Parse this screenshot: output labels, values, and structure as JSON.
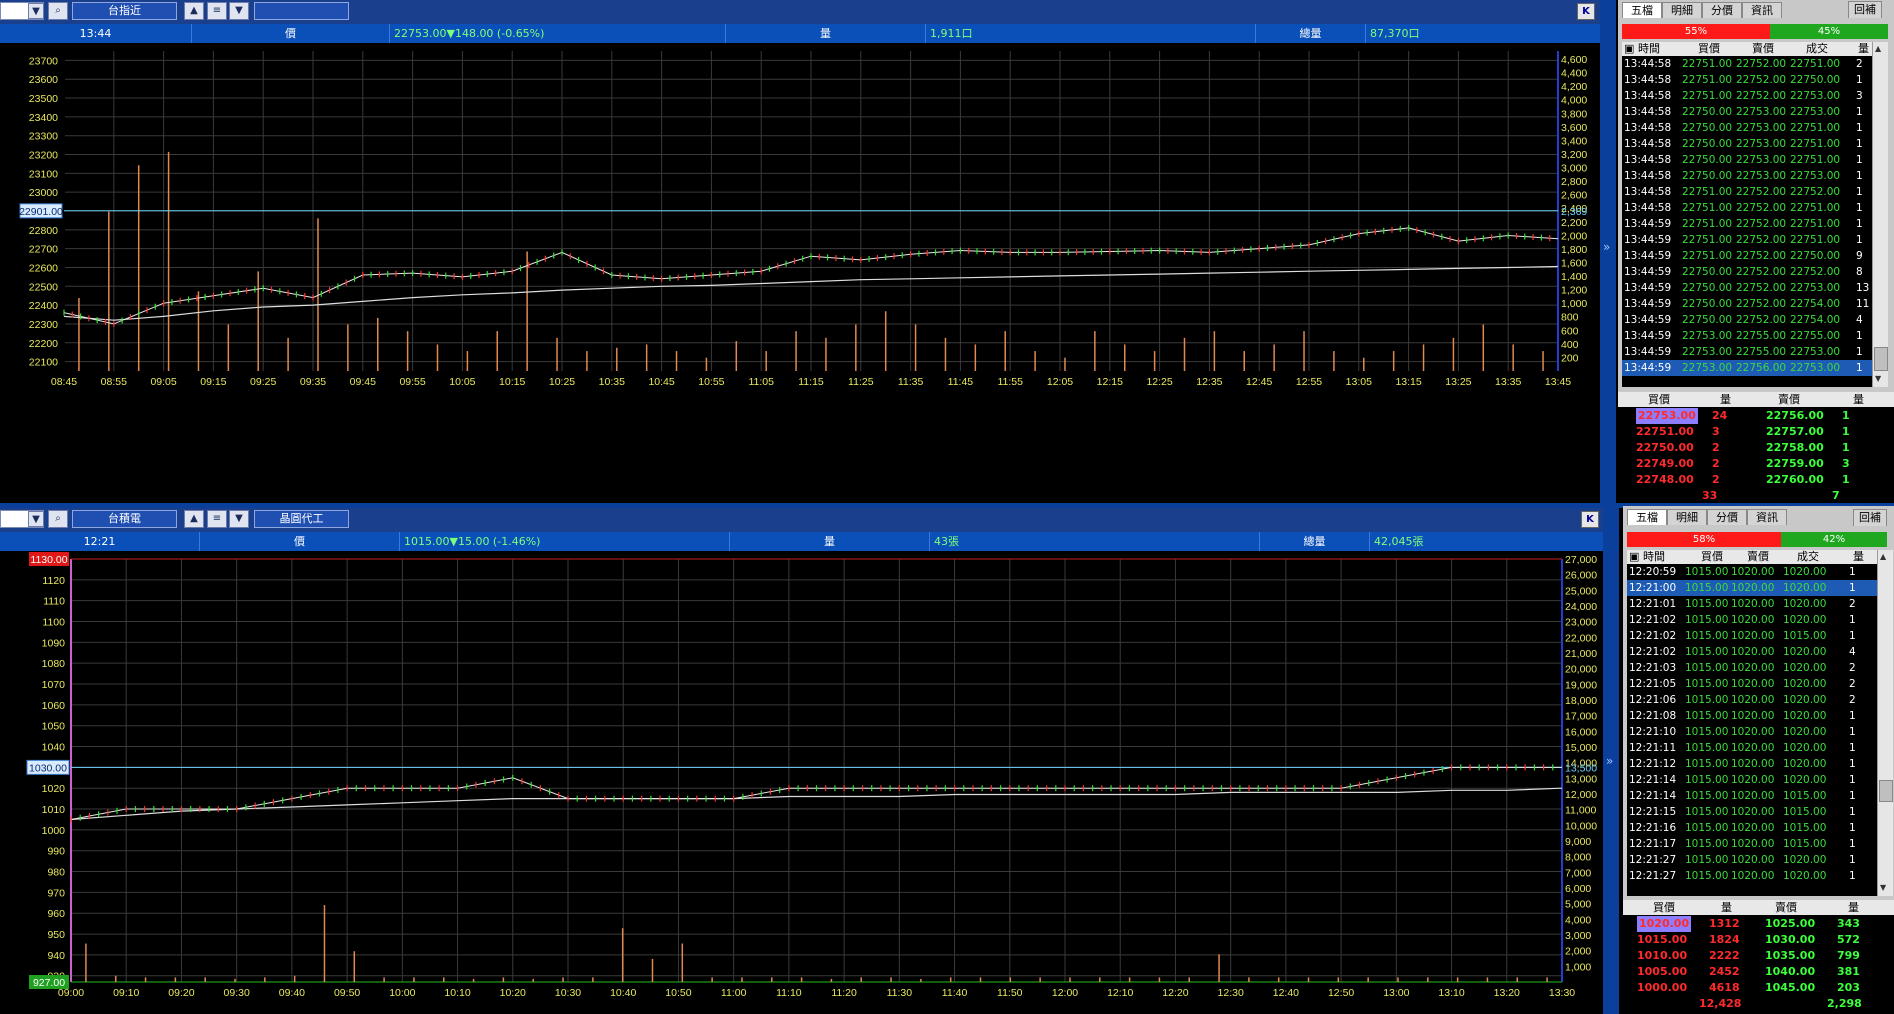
{
  "top": {
    "toolbar": {
      "code_value": "",
      "symbol_name": "台指近",
      "category": "",
      "k_label": "K"
    },
    "info": {
      "time": "13:44",
      "price_label": "價",
      "price_value": "22753.00▼148.00 (-0.65%)",
      "vol_label": "量",
      "vol_value": "1,911口",
      "total_label": "總量",
      "total_value": "87,370口"
    },
    "ref_price": "22901.00",
    "ref_right_label": "2,369",
    "y_ticks": [
      "23700",
      "23600",
      "23500",
      "23400",
      "23300",
      "23200",
      "23100",
      "23000",
      "22900",
      "22800",
      "22700",
      "22600",
      "22500",
      "22400",
      "22300",
      "22200",
      "22100"
    ],
    "vol_ticks": [
      "4,600",
      "4,400",
      "4,200",
      "4,000",
      "3,800",
      "3,600",
      "3,400",
      "3,200",
      "3,000",
      "2,800",
      "2,600",
      "2,400",
      "2,200",
      "2,000",
      "1,800",
      "1,600",
      "1,400",
      "1,200",
      "1,000",
      "800",
      "600",
      "400",
      "200"
    ],
    "x_ticks": [
      "08:45",
      "08:55",
      "09:05",
      "09:15",
      "09:25",
      "09:35",
      "09:45",
      "09:55",
      "10:05",
      "10:15",
      "10:25",
      "10:35",
      "10:45",
      "10:55",
      "11:05",
      "11:15",
      "11:25",
      "11:35",
      "11:45",
      "11:55",
      "12:05",
      "12:15",
      "12:25",
      "12:35",
      "12:45",
      "12:55",
      "13:05",
      "13:15",
      "13:25",
      "13:35",
      "13:45"
    ],
    "chart_data": {
      "type": "line",
      "series": [
        {
          "x": [
            "08:45",
            "08:55",
            "09:05",
            "09:15",
            "09:25",
            "09:35",
            "09:45",
            "09:55",
            "10:05",
            "10:15",
            "10:25",
            "10:35",
            "10:45",
            "10:55",
            "11:05",
            "11:15",
            "11:25",
            "11:35",
            "11:45",
            "11:55",
            "12:05",
            "12:15",
            "12:25",
            "12:35",
            "12:45",
            "12:55",
            "13:05",
            "13:15",
            "13:25",
            "13:35",
            "13:45"
          ],
          "values": [
            22360,
            22300,
            22410,
            22450,
            22490,
            22440,
            22560,
            22570,
            22550,
            22580,
            22680,
            22560,
            22540,
            22560,
            22580,
            22660,
            22640,
            22670,
            22690,
            22680,
            22680,
            22685,
            22690,
            22680,
            22700,
            22720,
            22780,
            22810,
            22740,
            22770,
            22753
          ]
        },
        {
          "x": [
            "08:45",
            "08:55",
            "09:05",
            "09:15",
            "09:25",
            "09:35",
            "09:45",
            "09:55",
            "10:05",
            "10:15",
            "10:25",
            "10:35",
            "10:45",
            "10:55",
            "11:05",
            "11:15",
            "11:25",
            "11:35",
            "11:45",
            "11:55",
            "12:05",
            "12:15",
            "12:25",
            "12:35",
            "12:45",
            "12:55",
            "13:05",
            "13:15",
            "13:25",
            "13:35",
            "13:45"
          ],
          "values": [
            22340,
            22320,
            22340,
            22370,
            22390,
            22400,
            22420,
            22440,
            22455,
            22465,
            22480,
            22490,
            22500,
            22505,
            22515,
            22525,
            22535,
            22540,
            22545,
            22550,
            22555,
            22560,
            22565,
            22570,
            22575,
            22580,
            22585,
            22590,
            22595,
            22600,
            22605
          ]
        }
      ],
      "ylim": [
        22050,
        23750
      ],
      "volume_max": 4700,
      "volumes": [
        1100,
        2400,
        3100,
        3300,
        1200,
        700,
        1500,
        500,
        2300,
        700,
        800,
        600,
        400,
        300,
        600,
        1800,
        500,
        300,
        350,
        400,
        300,
        200,
        450,
        300,
        600,
        500,
        700,
        900,
        700,
        500,
        400,
        600,
        300,
        200,
        600,
        400,
        300,
        500,
        600,
        300,
        400,
        600,
        300,
        200,
        300,
        400,
        500,
        700,
        400,
        300
      ]
    },
    "quote_panel": {
      "tabs": [
        "五檔",
        "明細",
        "分價",
        "資訊"
      ],
      "button": "回補",
      "buy_pct": "55%",
      "sell_pct": "45%",
      "tick_headers": [
        "時間",
        "買價",
        "賣價",
        "成交",
        "量"
      ],
      "ticks": [
        [
          "13:44:58",
          "22751.00",
          "22752.00",
          "22751.00",
          "2"
        ],
        [
          "13:44:58",
          "22751.00",
          "22752.00",
          "22750.00",
          "1"
        ],
        [
          "13:44:58",
          "22751.00",
          "22752.00",
          "22753.00",
          "3"
        ],
        [
          "13:44:58",
          "22750.00",
          "22753.00",
          "22753.00",
          "1"
        ],
        [
          "13:44:58",
          "22750.00",
          "22753.00",
          "22751.00",
          "1"
        ],
        [
          "13:44:58",
          "22750.00",
          "22753.00",
          "22751.00",
          "1"
        ],
        [
          "13:44:58",
          "22750.00",
          "22753.00",
          "22751.00",
          "1"
        ],
        [
          "13:44:58",
          "22750.00",
          "22753.00",
          "22753.00",
          "1"
        ],
        [
          "13:44:58",
          "22751.00",
          "22752.00",
          "22752.00",
          "1"
        ],
        [
          "13:44:58",
          "22751.00",
          "22752.00",
          "22751.00",
          "1"
        ],
        [
          "13:44:59",
          "22751.00",
          "22752.00",
          "22751.00",
          "1"
        ],
        [
          "13:44:59",
          "22751.00",
          "22752.00",
          "22751.00",
          "1"
        ],
        [
          "13:44:59",
          "22751.00",
          "22752.00",
          "22750.00",
          "9"
        ],
        [
          "13:44:59",
          "22750.00",
          "22752.00",
          "22752.00",
          "8"
        ],
        [
          "13:44:59",
          "22750.00",
          "22752.00",
          "22753.00",
          "13"
        ],
        [
          "13:44:59",
          "22750.00",
          "22752.00",
          "22754.00",
          "11"
        ],
        [
          "13:44:59",
          "22750.00",
          "22752.00",
          "22754.00",
          "4"
        ],
        [
          "13:44:59",
          "22753.00",
          "22755.00",
          "22755.00",
          "1"
        ],
        [
          "13:44:59",
          "22753.00",
          "22755.00",
          "22753.00",
          "1"
        ],
        [
          "13:44:59",
          "22753.00",
          "22756.00",
          "22753.00",
          "1"
        ]
      ],
      "book_headers": [
        "買價",
        "量",
        "賣價",
        "量"
      ],
      "book": [
        [
          "22753.00",
          "24",
          "22756.00",
          "1"
        ],
        [
          "22751.00",
          "3",
          "22757.00",
          "1"
        ],
        [
          "22750.00",
          "2",
          "22758.00",
          "1"
        ],
        [
          "22749.00",
          "2",
          "22759.00",
          "3"
        ],
        [
          "22748.00",
          "2",
          "22760.00",
          "1"
        ]
      ],
      "book_total_bid": "33",
      "book_total_ask": "7",
      "colors": {
        "bid": "#ff2b2b",
        "ask": "#3cff3c",
        "tick_text": "#3cdc3c"
      }
    }
  },
  "bottom": {
    "toolbar": {
      "code_value": "",
      "symbol_name": "台積電",
      "category": "晶圓代工",
      "k_label": "K"
    },
    "info": {
      "time": "12:21",
      "price_label": "價",
      "price_value": "1015.00▼15.00 (-1.46%)",
      "vol_label": "量",
      "vol_value": "43張",
      "total_label": "總量",
      "total_value": "42,045張"
    },
    "ref_price": "1030.00",
    "ref_right_label": "13,500",
    "limit_up": "1130.00",
    "limit_down": "927.00",
    "y_ticks": [
      "1120",
      "1110",
      "1100",
      "1090",
      "1080",
      "1070",
      "1060",
      "1050",
      "1040",
      "1030",
      "1020",
      "1010",
      "1000",
      "990",
      "980",
      "970",
      "960",
      "950",
      "940",
      "930"
    ],
    "vol_ticks": [
      "27,000",
      "26,000",
      "25,000",
      "24,000",
      "23,000",
      "22,000",
      "21,000",
      "20,000",
      "19,000",
      "18,000",
      "17,000",
      "16,000",
      "15,000",
      "14,000",
      "13,000",
      "12,000",
      "11,000",
      "10,000",
      "9,000",
      "8,000",
      "7,000",
      "6,000",
      "5,000",
      "4,000",
      "3,000",
      "2,000",
      "1,000"
    ],
    "x_ticks": [
      "09:00",
      "09:10",
      "09:20",
      "09:30",
      "09:40",
      "09:50",
      "10:00",
      "10:10",
      "10:20",
      "10:30",
      "10:40",
      "10:50",
      "11:00",
      "11:10",
      "11:20",
      "11:30",
      "11:40",
      "11:50",
      "12:00",
      "12:10",
      "12:20",
      "12:30",
      "12:40",
      "12:50",
      "13:00",
      "13:10",
      "13:20",
      "13:30"
    ],
    "chart_data": {
      "type": "line",
      "series": [
        {
          "x": [
            "09:00",
            "09:10",
            "09:20",
            "09:30",
            "09:40",
            "09:50",
            "10:00",
            "10:10",
            "10:20",
            "10:30",
            "10:40",
            "10:50",
            "11:00",
            "11:10",
            "11:20",
            "11:30",
            "11:40",
            "11:50",
            "12:00",
            "12:10",
            "12:20",
            "12:30",
            "12:40",
            "12:50",
            "13:00",
            "13:10",
            "13:20",
            "13:30"
          ],
          "values": [
            1005,
            1010,
            1010,
            1010,
            1015,
            1020,
            1020,
            1020,
            1025,
            1015,
            1015,
            1015,
            1015,
            1020,
            1020,
            1020,
            1020,
            1020,
            1020,
            1020,
            1020,
            1020,
            1020,
            1020,
            1025,
            1030,
            1030,
            1030
          ]
        },
        {
          "x": [
            "09:00",
            "09:10",
            "09:20",
            "09:30",
            "09:40",
            "09:50",
            "10:00",
            "10:10",
            "10:20",
            "10:30",
            "10:40",
            "10:50",
            "11:00",
            "11:10",
            "11:20",
            "11:30",
            "11:40",
            "11:50",
            "12:00",
            "12:10",
            "12:20",
            "12:30",
            "12:40",
            "12:50",
            "13:00",
            "13:10",
            "13:20",
            "13:30"
          ],
          "values": [
            1005,
            1007,
            1009,
            1010,
            1011,
            1012,
            1013,
            1014,
            1015,
            1015,
            1015,
            1015,
            1015,
            1016,
            1016,
            1016,
            1017,
            1017,
            1017,
            1017,
            1017,
            1018,
            1018,
            1018,
            1018,
            1019,
            1019,
            1020
          ]
        }
      ],
      "ylim": [
        927,
        1130
      ],
      "volume_max": 27500,
      "volumes": [
        2500,
        400,
        300,
        300,
        300,
        200,
        300,
        400,
        5000,
        2000,
        300,
        300,
        300,
        200,
        300,
        200,
        300,
        300,
        3500,
        1500,
        2500,
        300,
        300,
        300,
        300,
        200,
        300,
        300,
        200,
        300,
        300,
        300,
        300,
        300,
        300,
        300,
        300,
        300,
        1800,
        300,
        300,
        300,
        300,
        300,
        300,
        300,
        300,
        300,
        300,
        300
      ]
    },
    "quote_panel": {
      "tabs": [
        "五檔",
        "明細",
        "分價",
        "資訊"
      ],
      "button": "回補",
      "buy_pct": "58%",
      "sell_pct": "42%",
      "tick_headers": [
        "時間",
        "買價",
        "賣價",
        "成交",
        "量"
      ],
      "ticks": [
        [
          "12:20:59",
          "1015.00",
          "1020.00",
          "1020.00",
          "1"
        ],
        [
          "12:21:00",
          "1015.00",
          "1020.00",
          "1020.00",
          "1"
        ],
        [
          "12:21:01",
          "1015.00",
          "1020.00",
          "1020.00",
          "2"
        ],
        [
          "12:21:02",
          "1015.00",
          "1020.00",
          "1020.00",
          "1"
        ],
        [
          "12:21:02",
          "1015.00",
          "1020.00",
          "1015.00",
          "1"
        ],
        [
          "12:21:02",
          "1015.00",
          "1020.00",
          "1020.00",
          "4"
        ],
        [
          "12:21:03",
          "1015.00",
          "1020.00",
          "1020.00",
          "2"
        ],
        [
          "12:21:05",
          "1015.00",
          "1020.00",
          "1020.00",
          "2"
        ],
        [
          "12:21:06",
          "1015.00",
          "1020.00",
          "1020.00",
          "2"
        ],
        [
          "12:21:08",
          "1015.00",
          "1020.00",
          "1020.00",
          "1"
        ],
        [
          "12:21:10",
          "1015.00",
          "1020.00",
          "1020.00",
          "1"
        ],
        [
          "12:21:11",
          "1015.00",
          "1020.00",
          "1020.00",
          "1"
        ],
        [
          "12:21:12",
          "1015.00",
          "1020.00",
          "1020.00",
          "1"
        ],
        [
          "12:21:14",
          "1015.00",
          "1020.00",
          "1020.00",
          "1"
        ],
        [
          "12:21:14",
          "1015.00",
          "1020.00",
          "1015.00",
          "1"
        ],
        [
          "12:21:15",
          "1015.00",
          "1020.00",
          "1015.00",
          "1"
        ],
        [
          "12:21:16",
          "1015.00",
          "1020.00",
          "1015.00",
          "1"
        ],
        [
          "12:21:17",
          "1015.00",
          "1020.00",
          "1015.00",
          "1"
        ],
        [
          "12:21:27",
          "1015.00",
          "1020.00",
          "1020.00",
          "1"
        ],
        [
          "12:21:27",
          "1015.00",
          "1020.00",
          "1020.00",
          "1"
        ]
      ],
      "book_headers": [
        "買價",
        "量",
        "賣價",
        "量"
      ],
      "book": [
        [
          "1020.00",
          "1312",
          "1025.00",
          "343"
        ],
        [
          "1015.00",
          "1824",
          "1030.00",
          "572"
        ],
        [
          "1010.00",
          "2222",
          "1035.00",
          "799"
        ],
        [
          "1005.00",
          "2452",
          "1040.00",
          "381"
        ],
        [
          "1000.00",
          "4618",
          "1045.00",
          "203"
        ]
      ],
      "book_total_bid": "12,428",
      "book_total_ask": "2,298",
      "colors": {
        "bid": "#ff2b2b",
        "ask": "#3cff3c",
        "tick_text": "#3cdc3c"
      }
    }
  }
}
